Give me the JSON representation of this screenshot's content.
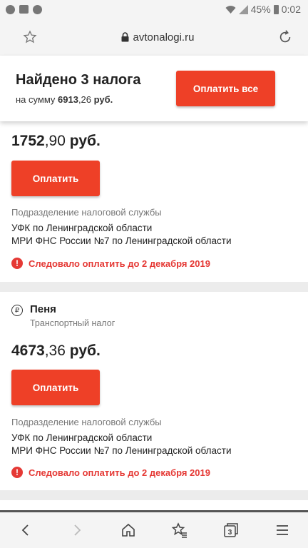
{
  "status_bar": {
    "battery": "45%",
    "time": "0:02"
  },
  "browser": {
    "url": "avtonalogi.ru"
  },
  "summary": {
    "title": "Найдено 3 налога",
    "sum_prefix": "на сумму ",
    "sum_whole": "6913",
    "sum_frac": ",26",
    "sum_currency": "руб.",
    "pay_all_label": "Оплатить все"
  },
  "cards": [
    {
      "amount_whole": "1752",
      "amount_frac": ",90",
      "amount_currency": "руб.",
      "pay_label": "Оплатить",
      "dept_label": "Подразделение налоговой службы",
      "dept_line1": "УФК по Ленинградской области",
      "dept_line2": "МРИ ФНС России №7 по Ленинградской области",
      "warning": "Следовало оплатить до 2 декабря 2019"
    },
    {
      "tax_icon": "₽",
      "tax_name": "Пеня",
      "tax_type": "Транспортный налог",
      "amount_whole": "4673",
      "amount_frac": ",36",
      "amount_currency": "руб.",
      "pay_label": "Оплатить",
      "dept_label": "Подразделение налоговой службы",
      "dept_line1": "УФК по Ленинградской области",
      "dept_line2": "МРИ ФНС России №7 по Ленинградской области",
      "warning": "Следовало оплатить до 2 декабря 2019"
    }
  ],
  "bottom_nav": {
    "tabs_count": "3"
  },
  "colors": {
    "accent": "#ee4027",
    "warning": "#e53935"
  }
}
